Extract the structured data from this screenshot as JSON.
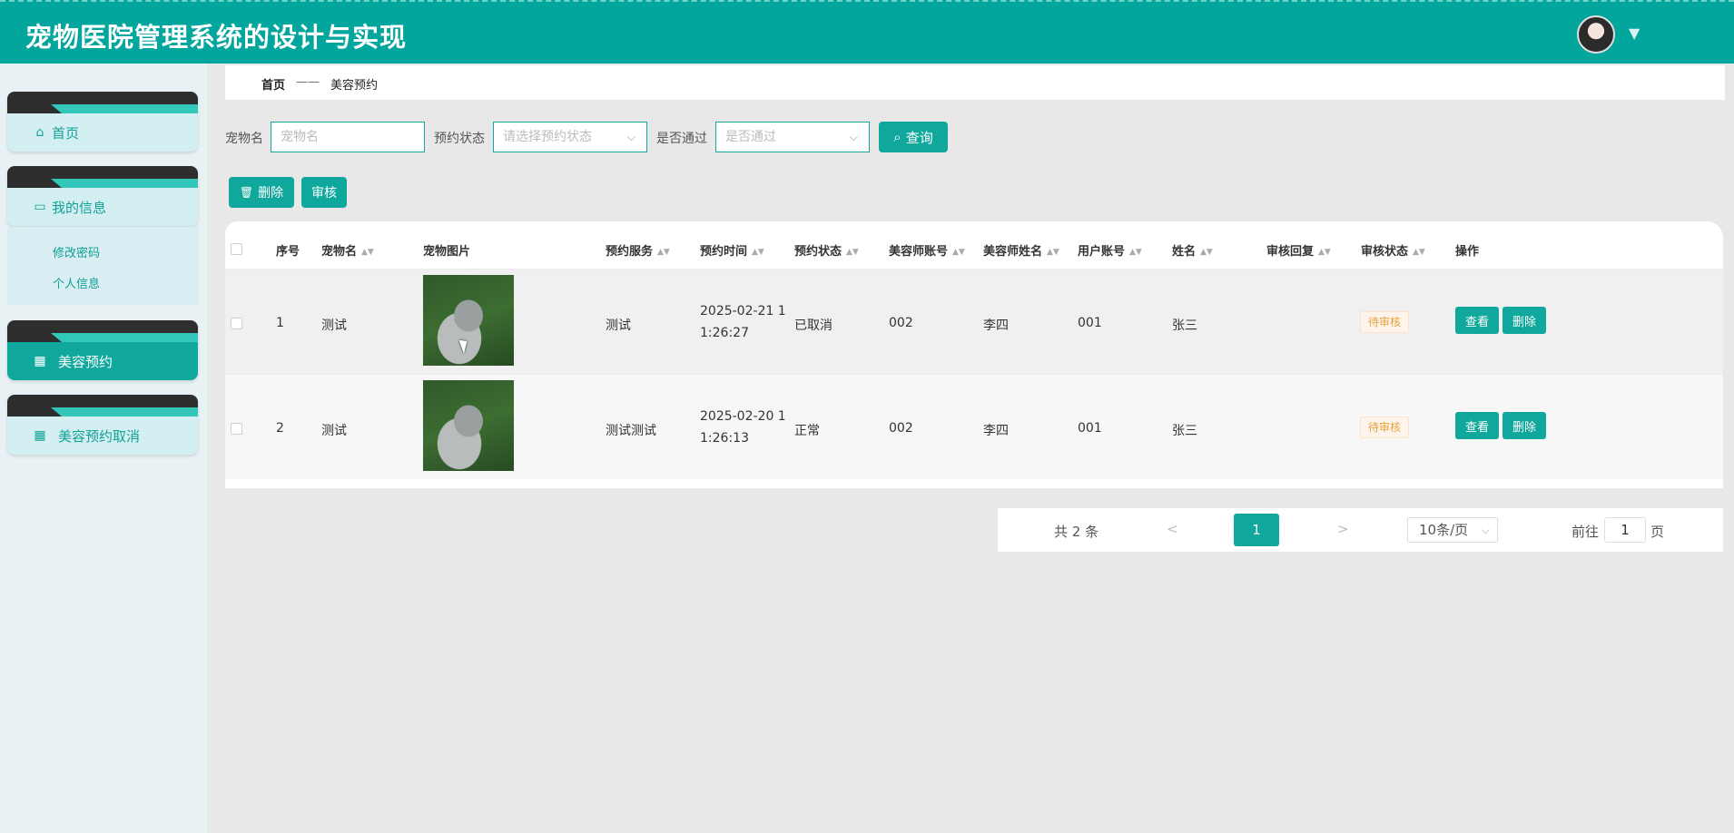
{
  "header": {
    "title": "宠物医院管理系统的设计与实现"
  },
  "sidebar": {
    "items": [
      {
        "label": "首页",
        "icon": "home-icon"
      },
      {
        "label": "我的信息",
        "icon": "card-icon"
      },
      {
        "label": "美容预约",
        "icon": "grid-icon"
      },
      {
        "label": "美容预约取消",
        "icon": "grid9-icon"
      }
    ],
    "sub_items": [
      "修改密码",
      "个人信息"
    ]
  },
  "breadcrumb": {
    "home": "首页",
    "sep": "——",
    "current": "美容预约"
  },
  "search": {
    "pet_label": "宠物名",
    "pet_placeholder": "宠物名",
    "status_label": "预约状态",
    "status_placeholder": "请选择预约状态",
    "pass_label": "是否通过",
    "pass_placeholder": "是否通过",
    "query_label": "查询"
  },
  "toolbar": {
    "delete_label": "删除",
    "review_label": "审核"
  },
  "table": {
    "headers": [
      "序号",
      "宠物名",
      "宠物图片",
      "预约服务",
      "预约时间",
      "预约状态",
      "美容师账号",
      "美容师姓名",
      "用户账号",
      "姓名",
      "审核回复",
      "审核状态",
      "操作"
    ],
    "rows": [
      {
        "no": "1",
        "pet": "测试",
        "service": "测试",
        "time_1": "2025-02-21 1",
        "time_2": "1:26:27",
        "status": "已取消",
        "groomer_acct": "002",
        "groomer_name": "李四",
        "user_acct": "001",
        "name": "张三",
        "reply": "",
        "review": "待审核"
      },
      {
        "no": "2",
        "pet": "测试",
        "service": "测试测试",
        "time_1": "2025-02-20 1",
        "time_2": "1:26:13",
        "status": "正常",
        "groomer_acct": "002",
        "groomer_name": "李四",
        "user_acct": "001",
        "name": "张三",
        "reply": "",
        "review": "待审核"
      }
    ],
    "view_label": "查看",
    "delete_label": "删除"
  },
  "pagination": {
    "total": "共 2 条",
    "prev": "<",
    "current": "1",
    "next": ">",
    "page_size": "10条/页",
    "goto_label": "前往",
    "goto_value": "1",
    "page_suffix": "页"
  },
  "colors": {
    "primary": "#03a69c",
    "button": "#10a89d",
    "warning": "#e6a23c"
  }
}
